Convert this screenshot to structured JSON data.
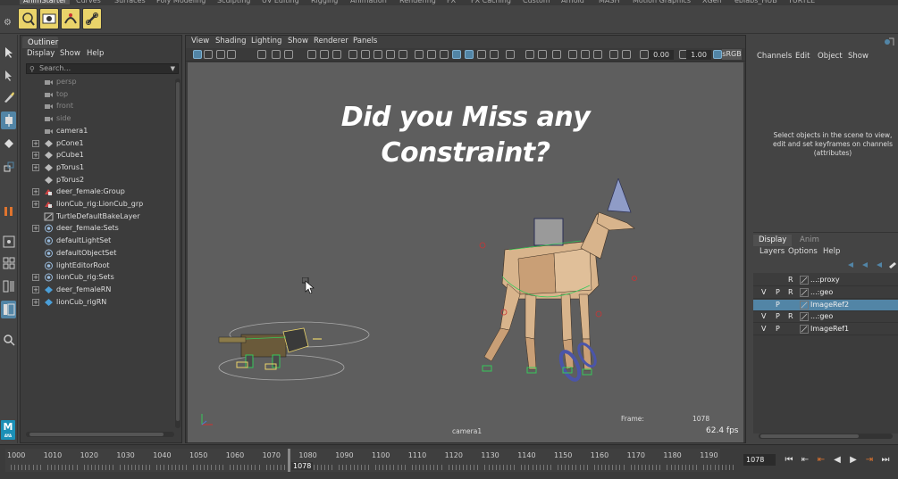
{
  "shelf": {
    "tabs": [
      "AnimStarter",
      "Curves",
      "Surfaces",
      "Poly Modeling",
      "Sculpting",
      "UV Editing",
      "Rigging",
      "Animation",
      "Rendering",
      "FX",
      "FX Caching",
      "Custom",
      "Arnold",
      "MASH",
      "Motion Graphics",
      "XGen",
      "eblabs_HUB",
      "TURTLE"
    ],
    "active_tab": "AnimStarter",
    "icons": [
      "shelf-tool-1-icon",
      "shelf-tool-2-icon",
      "shelf-tool-3-icon",
      "shelf-tool-4-icon"
    ]
  },
  "outliner": {
    "tab_label": "Outliner",
    "menu": [
      "Display",
      "Show",
      "Help"
    ],
    "search_placeholder": "Search...",
    "items": [
      {
        "label": "persp",
        "dim": true,
        "expandable": false,
        "icon": "camera-icon"
      },
      {
        "label": "top",
        "dim": true,
        "expandable": false,
        "icon": "camera-icon"
      },
      {
        "label": "front",
        "dim": true,
        "expandable": false,
        "icon": "camera-icon"
      },
      {
        "label": "side",
        "dim": true,
        "expandable": false,
        "icon": "camera-icon"
      },
      {
        "label": "camera1",
        "dim": false,
        "expandable": false,
        "icon": "camera-icon"
      },
      {
        "label": "pCone1",
        "dim": false,
        "expandable": true,
        "icon": "mesh-icon"
      },
      {
        "label": "pCube1",
        "dim": false,
        "expandable": true,
        "icon": "mesh-icon"
      },
      {
        "label": "pTorus1",
        "dim": false,
        "expandable": true,
        "icon": "mesh-icon"
      },
      {
        "label": "pTorus2",
        "dim": false,
        "expandable": false,
        "icon": "mesh-icon"
      },
      {
        "label": "deer_female:Group",
        "dim": false,
        "expandable": true,
        "icon": "group-icon"
      },
      {
        "label": "lionCub_rig:LionCub_grp",
        "dim": false,
        "expandable": true,
        "icon": "group-icon"
      },
      {
        "label": "TurtleDefaultBakeLayer",
        "dim": false,
        "expandable": false,
        "icon": "bake-layer-icon"
      },
      {
        "label": "deer_female:Sets",
        "dim": false,
        "expandable": true,
        "icon": "set-icon"
      },
      {
        "label": "defaultLightSet",
        "dim": false,
        "expandable": false,
        "icon": "set-icon"
      },
      {
        "label": "defaultObjectSet",
        "dim": false,
        "expandable": false,
        "icon": "set-icon"
      },
      {
        "label": "lightEditorRoot",
        "dim": false,
        "expandable": false,
        "icon": "set-icon"
      },
      {
        "label": "lionCub_rig:Sets",
        "dim": false,
        "expandable": true,
        "icon": "set-icon"
      },
      {
        "label": "deer_femaleRN",
        "dim": false,
        "expandable": true,
        "icon": "reference-icon"
      },
      {
        "label": "lionCub_rigRN",
        "dim": false,
        "expandable": true,
        "icon": "reference-icon"
      }
    ]
  },
  "viewport": {
    "menu": [
      "View",
      "Shading",
      "Lighting",
      "Show",
      "Renderer",
      "Panels"
    ],
    "exposure": "0.00",
    "gamma": "1.00",
    "color_space": "sRGB",
    "title_line1": "Did you Miss any",
    "title_line2": "Constraint?",
    "hud_frame_label": "Frame:",
    "hud_frame_value": "1078",
    "hud_camera": "camera1",
    "hud_fps": "62.4 fps"
  },
  "channel_box": {
    "menu": [
      "Channels",
      "Edit",
      "Object",
      "Show"
    ],
    "message": "Select objects in the scene to view, edit and set keyframes on channels (attributes)"
  },
  "layer_editor": {
    "tabs": [
      "Display",
      "Anim"
    ],
    "active_tab": "Display",
    "menu": [
      "Layers",
      "Options",
      "Help"
    ],
    "layers": [
      {
        "v": "",
        "p": "",
        "r": "R",
        "name": "...:proxy",
        "selected": false
      },
      {
        "v": "V",
        "p": "P",
        "r": "R",
        "name": "...:geo",
        "selected": false
      },
      {
        "v": "",
        "p": "P",
        "r": "",
        "name": "ImageRef2",
        "selected": true
      },
      {
        "v": "V",
        "p": "P",
        "r": "R",
        "name": "...:geo",
        "selected": false
      },
      {
        "v": "V",
        "p": "P",
        "r": "",
        "name": "ImageRef1",
        "selected": false
      }
    ]
  },
  "timeline": {
    "ticks": [
      "1000",
      "1010",
      "1020",
      "1030",
      "1040",
      "1050",
      "1060",
      "1070",
      "1080",
      "1090",
      "1100",
      "1110",
      "1120",
      "1130",
      "1140",
      "1150",
      "1160",
      "1170",
      "1180",
      "1190"
    ],
    "current_frame": "1078",
    "current_frame_field": "1078",
    "controls": [
      "go-to-start-icon",
      "step-back-key-icon",
      "step-back-frame-icon",
      "play-backward-icon",
      "play-forward-icon",
      "step-forward-frame-icon",
      "step-forward-key-icon",
      "go-to-end-icon"
    ]
  },
  "colors": {
    "selection_blue": "#5285a6",
    "viewport_bg": "#5e5e5e",
    "shelf_icon_yellow": "#e9d36a",
    "maya_logo": "#1b8fb6"
  }
}
